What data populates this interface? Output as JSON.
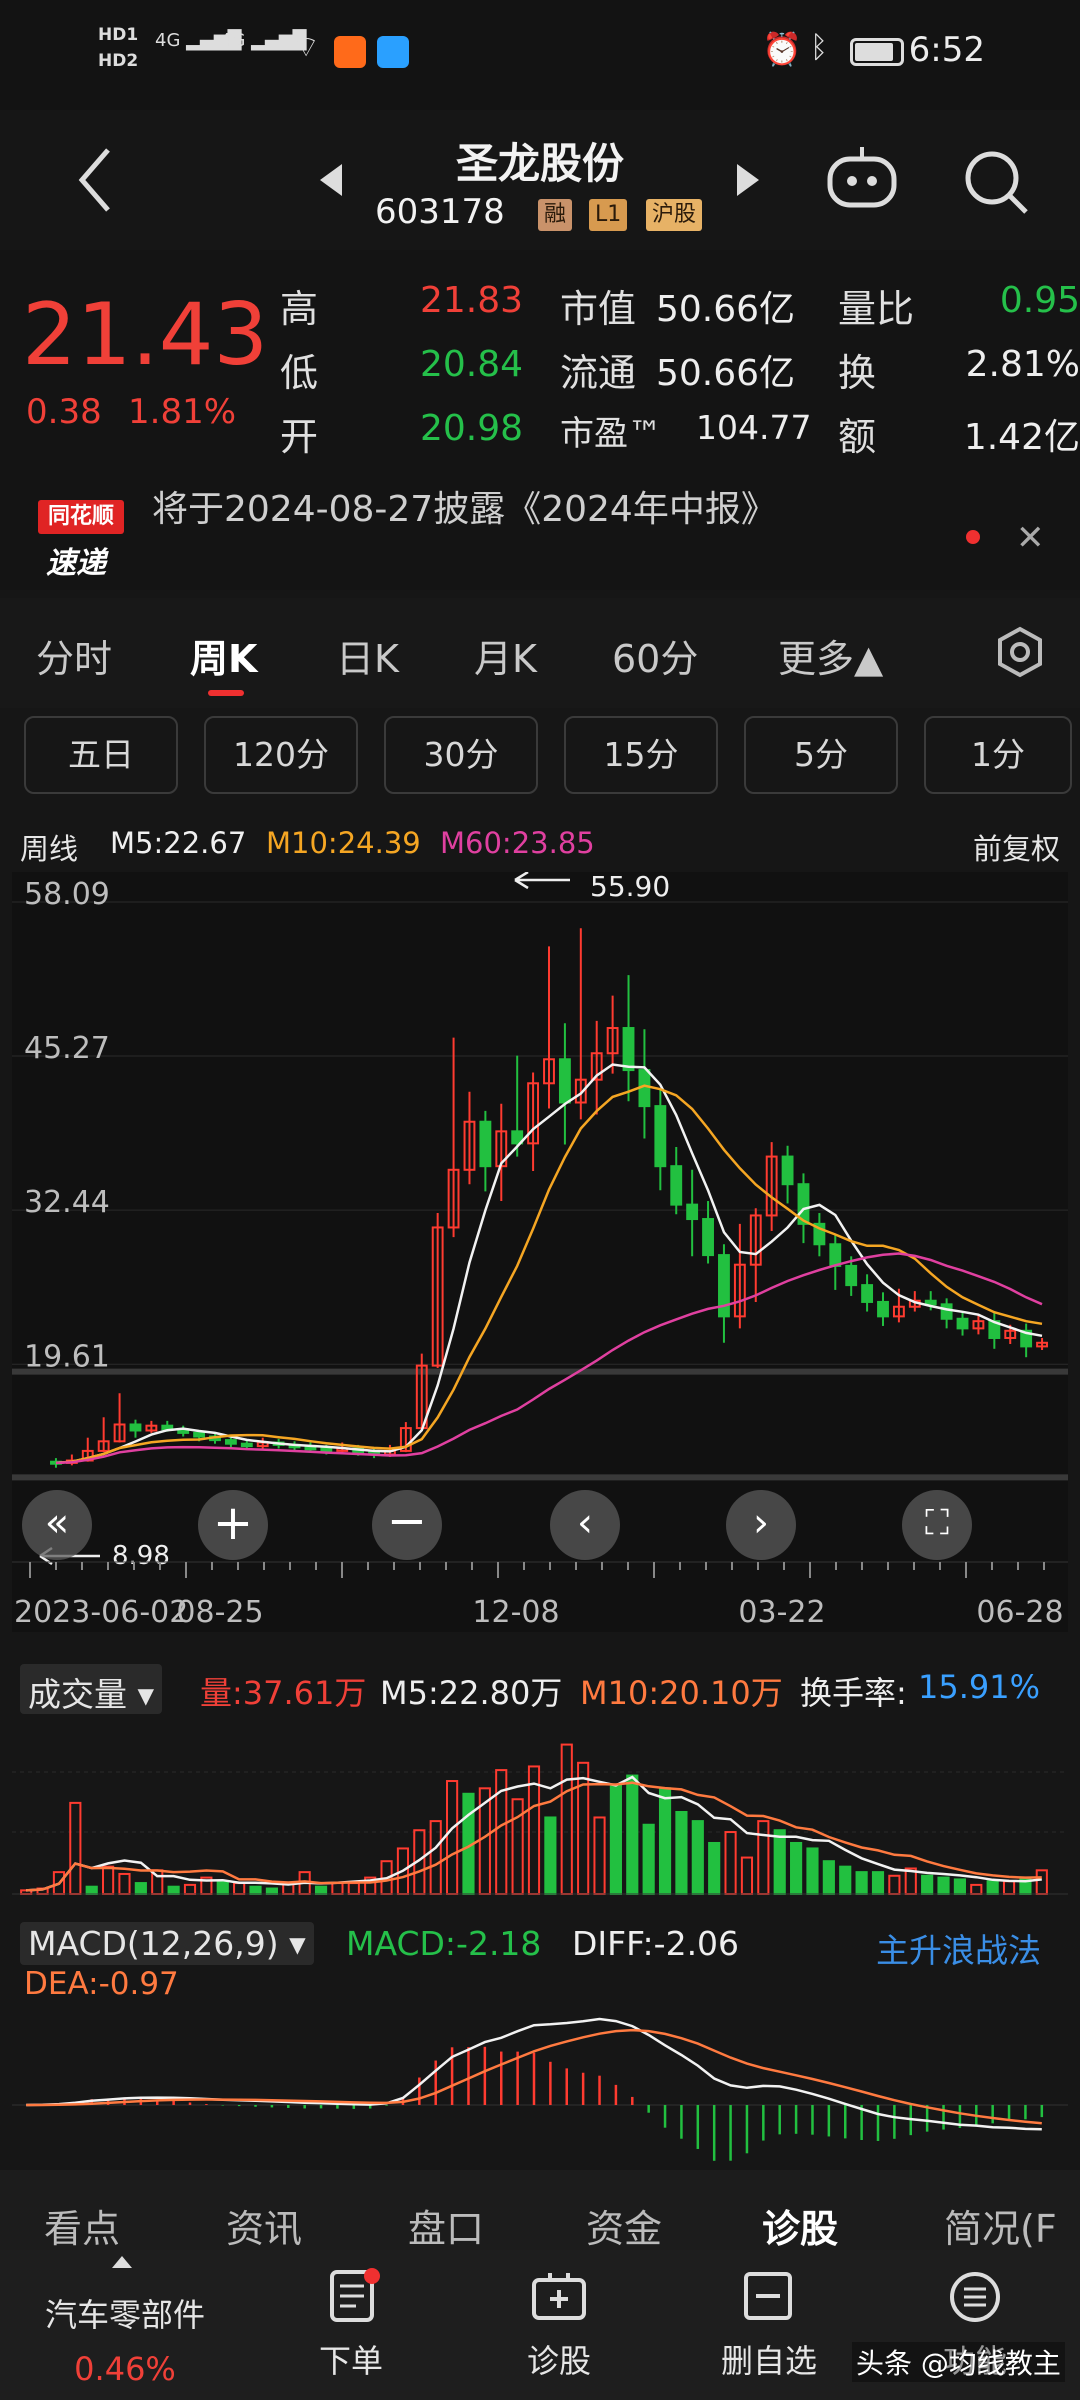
{
  "status_bar": {
    "time": "6:52",
    "hd1": "HD1",
    "hd2": "HD2",
    "net1": "4G",
    "net2": "4G"
  },
  "header": {
    "stock_name": "圣龙股份",
    "stock_code": "603178",
    "tags": [
      "融",
      "L1",
      "沪股"
    ]
  },
  "quote": {
    "price": "21.43",
    "change": "0.38",
    "change_pct": "1.81%",
    "high_label": "高",
    "high": "21.83",
    "low_label": "低",
    "low": "20.84",
    "open_label": "开",
    "open": "20.98",
    "mcap_label": "市值",
    "mcap": "50.66亿",
    "float_label": "流通",
    "float": "50.66亿",
    "pe_label": "市盈™",
    "pe": "104.77",
    "vr_label": "量比",
    "vr": "0.95",
    "turnover_label": "换",
    "turnover": "2.81%",
    "amount_label": "额",
    "amount": "1.42亿"
  },
  "banner": {
    "logo_top": "同花顺",
    "logo_bottom": "速递",
    "text": "将于2024-08-27披露《2024年中报》"
  },
  "tabs": [
    "分时",
    "周K",
    "日K",
    "月K",
    "60分",
    "更多▲"
  ],
  "periods": [
    "五日",
    "120分",
    "30分",
    "15分",
    "5分",
    "1分"
  ],
  "ma_bar": {
    "period": "周线",
    "m5": "M5:22.67",
    "m10": "M10:24.39",
    "m60": "M60:23.85",
    "adjust": "前复权"
  },
  "chart_data": [
    {
      "type": "candlestick",
      "title": "周线",
      "ylabels": [
        "58.09",
        "45.27",
        "32.44",
        "19.61"
      ],
      "ylim": [
        8.98,
        58.09
      ],
      "xlabels": [
        "2023-06-02",
        "08-25",
        "12-08",
        "03-22",
        "06-28"
      ],
      "annotations": {
        "high": "55.90",
        "low": "8.98"
      },
      "series": [
        {
          "name": "M5"
        },
        {
          "name": "M10"
        },
        {
          "name": "M60"
        }
      ],
      "candles": [
        [
          11.5,
          11.4,
          11.8,
          11.0
        ],
        [
          11.4,
          11.6,
          12.1,
          11.2
        ],
        [
          11.6,
          12.4,
          13.5,
          11.5
        ],
        [
          12.4,
          13.2,
          15.2,
          12.3
        ],
        [
          13.2,
          14.6,
          17.2,
          13.1
        ],
        [
          14.6,
          14.1,
          15.0,
          13.5
        ],
        [
          14.1,
          14.5,
          14.9,
          13.9
        ],
        [
          14.5,
          14.2,
          14.9,
          14.0
        ],
        [
          14.2,
          13.9,
          14.5,
          13.6
        ],
        [
          13.9,
          13.6,
          14.1,
          13.2
        ],
        [
          13.6,
          13.3,
          13.8,
          13.0
        ],
        [
          13.3,
          13.0,
          13.5,
          12.7
        ],
        [
          13.0,
          12.8,
          13.3,
          12.5
        ],
        [
          12.8,
          13.1,
          13.5,
          12.5
        ],
        [
          13.1,
          12.9,
          13.4,
          12.6
        ],
        [
          12.9,
          12.7,
          13.2,
          12.4
        ],
        [
          12.7,
          12.6,
          13.1,
          12.3
        ],
        [
          12.6,
          12.4,
          12.9,
          12.1
        ],
        [
          12.4,
          12.6,
          13.1,
          12.2
        ],
        [
          12.6,
          12.3,
          12.9,
          12.0
        ],
        [
          12.3,
          12.1,
          12.6,
          11.8
        ],
        [
          12.1,
          12.4,
          12.9,
          11.9
        ],
        [
          12.4,
          14.3,
          14.8,
          12.3
        ],
        [
          14.3,
          19.5,
          20.5,
          14.2
        ],
        [
          19.5,
          31.0,
          32.2,
          19.3
        ],
        [
          31.0,
          35.8,
          46.8,
          30.2
        ],
        [
          35.8,
          39.8,
          42.3,
          34.6
        ],
        [
          39.8,
          36.1,
          40.7,
          34.0
        ],
        [
          36.1,
          39.0,
          41.3,
          33.2
        ],
        [
          39.0,
          38.0,
          45.3,
          36.9
        ],
        [
          38.0,
          43.0,
          43.9,
          35.7
        ],
        [
          43.0,
          45.0,
          54.4,
          40.9
        ],
        [
          45.0,
          41.4,
          48.0,
          37.9
        ],
        [
          41.4,
          43.3,
          55.9,
          40.0
        ],
        [
          43.3,
          45.5,
          48.2,
          40.4
        ],
        [
          45.5,
          47.6,
          50.3,
          43.8
        ],
        [
          47.6,
          44.1,
          52.0,
          41.5
        ],
        [
          44.1,
          41.1,
          47.5,
          38.4
        ],
        [
          41.1,
          36.1,
          42.5,
          34.1
        ],
        [
          36.1,
          32.9,
          37.7,
          32.1
        ],
        [
          32.9,
          31.7,
          35.8,
          28.6
        ],
        [
          31.7,
          28.7,
          33.2,
          28.0
        ],
        [
          28.7,
          23.6,
          29.6,
          21.4
        ],
        [
          23.6,
          27.9,
          31.3,
          22.6
        ],
        [
          27.9,
          32.0,
          32.6,
          24.8
        ],
        [
          32.0,
          36.9,
          38.1,
          30.7
        ],
        [
          36.9,
          34.6,
          37.8,
          33.0
        ],
        [
          34.6,
          31.3,
          35.5,
          29.7
        ],
        [
          31.3,
          29.6,
          32.2,
          28.6
        ],
        [
          29.6,
          27.8,
          30.4,
          25.8
        ],
        [
          27.8,
          26.2,
          28.6,
          25.3
        ],
        [
          26.2,
          24.8,
          27.1,
          24.0
        ],
        [
          24.8,
          23.6,
          25.6,
          22.8
        ],
        [
          23.6,
          24.4,
          25.9,
          23.1
        ],
        [
          24.4,
          24.9,
          25.7,
          24.0
        ],
        [
          24.9,
          24.6,
          25.7,
          24.1
        ],
        [
          24.6,
          23.4,
          25.1,
          22.6
        ],
        [
          23.4,
          22.6,
          24.0,
          22.0
        ],
        [
          22.6,
          23.2,
          23.8,
          22.1
        ],
        [
          23.2,
          21.8,
          23.9,
          20.9
        ],
        [
          21.8,
          22.4,
          22.9,
          21.3
        ],
        [
          22.4,
          21.1,
          23.0,
          20.2
        ],
        [
          21.1,
          21.4,
          21.8,
          20.8
        ]
      ]
    },
    {
      "type": "bar",
      "title": "成交量",
      "labels": {
        "vol": "量:37.61万",
        "m5": "M5:22.80万",
        "m10": "M10:20.10万",
        "turnover_label": "换手率:",
        "turnover": "15.91%"
      },
      "series": [
        {
          "name": "M5"
        },
        {
          "name": "M10"
        }
      ],
      "values": [
        2,
        3,
        12,
        50,
        4,
        15,
        11,
        6,
        13,
        4,
        5,
        9,
        7,
        6,
        4,
        3,
        6,
        12,
        4,
        6,
        6,
        9,
        18,
        25,
        35,
        40,
        62,
        55,
        58,
        68,
        52,
        70,
        42,
        82,
        72,
        42,
        60,
        65,
        38,
        58,
        45,
        40,
        28,
        34,
        20,
        40,
        35,
        28,
        25,
        18,
        15,
        12,
        12,
        10,
        14,
        10,
        9,
        8,
        5,
        7,
        7,
        8,
        13
      ],
      "up": [
        1,
        1,
        1,
        1,
        0,
        1,
        1,
        0,
        1,
        0,
        1,
        1,
        0,
        1,
        0,
        0,
        1,
        1,
        0,
        1,
        1,
        1,
        1,
        1,
        1,
        1,
        1,
        0,
        1,
        1,
        1,
        1,
        0,
        1,
        1,
        1,
        0,
        0,
        0,
        0,
        0,
        0,
        0,
        1,
        1,
        1,
        0,
        0,
        0,
        0,
        0,
        0,
        0,
        1,
        1,
        0,
        0,
        0,
        1,
        0,
        1,
        0,
        1
      ]
    },
    {
      "type": "bar",
      "title": "MACD",
      "labels": {
        "name": "MACD(12,26,9)",
        "macd": "MACD:-2.18",
        "diff": "DIFF:-2.06",
        "dea": "DEA:-0.97",
        "strategy": "主升浪战法"
      },
      "series": [
        {
          "name": "DIFF"
        },
        {
          "name": "DEA"
        }
      ],
      "values": []
    }
  ],
  "bottom_tabs": [
    "看点",
    "资讯",
    "盘口",
    "资金",
    "诊股",
    "简况(F"
  ],
  "bottom_bar": {
    "sector": "汽车零部件",
    "sector_chg": "0.46%",
    "order": "下单",
    "diagnose": "诊股",
    "remove": "删自选",
    "more": "功能",
    "watermark": "头条 @均线教主"
  }
}
